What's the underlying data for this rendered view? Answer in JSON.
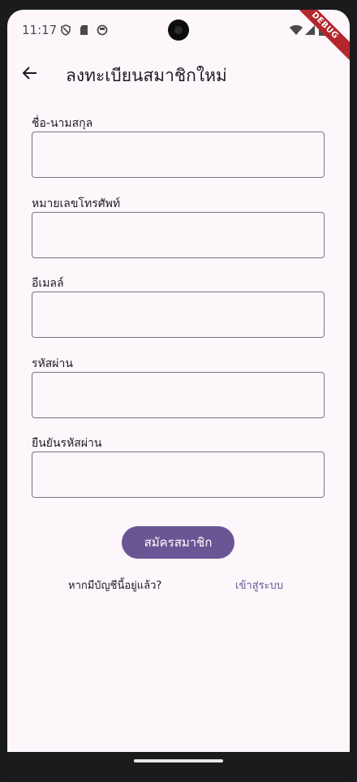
{
  "status_bar": {
    "time": "11:17",
    "debug_label": "DEBUG"
  },
  "app_bar": {
    "title": "ลงทะเบียนสมาชิกใหม่"
  },
  "form": {
    "fields": [
      {
        "label": "ชื่อ-นามสกุล",
        "value": ""
      },
      {
        "label": "หมายเลขโทรศัพท์",
        "value": ""
      },
      {
        "label": "อีเมลล์",
        "value": ""
      },
      {
        "label": "รหัสผ่าน",
        "value": ""
      },
      {
        "label": "ยืนยันรหัสผ่าน",
        "value": ""
      }
    ],
    "submit_label": "สมัครสมาชิก",
    "have_account_text": "หากมีบัญชีนี้อยู่แล้ว?",
    "login_link_label": "เข้าสู่ระบบ"
  },
  "colors": {
    "background": "#fdf7fc",
    "primary": "#6a5694",
    "outline": "#79747e",
    "debug_ribbon": "#b3262d"
  },
  "icons": {
    "back": "arrow-back-icon",
    "status": [
      "shield-icon",
      "sd-card-icon",
      "circle-status-icon",
      "wifi-icon",
      "signal-icon",
      "battery-icon"
    ]
  }
}
